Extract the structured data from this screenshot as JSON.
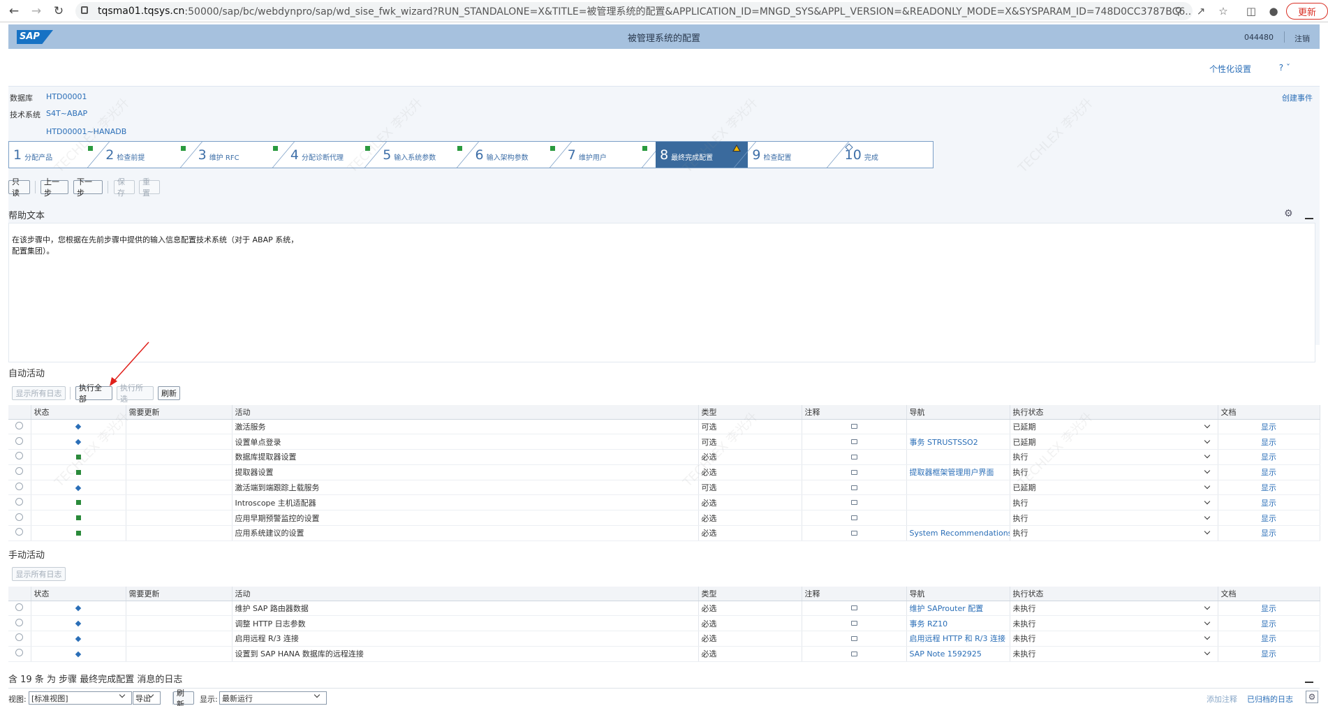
{
  "browser": {
    "url_host": "tqsma01.tqsys.cn",
    "url_rest": ":50000/sap/bc/webdynpro/sap/wd_sise_fwk_wizard?RUN_STANDALONE=X&TITLE=被管理系统的配置&APPLICATION_ID=MNGD_SYS&APPL_VERSION=&READONLY_MODE=X&SYSPARAM_ID=748D0CC3787BC6...",
    "update_label": "更新"
  },
  "header": {
    "logo": "SAP",
    "title": "被管理系统的配置",
    "user": "044480",
    "logout": "注销"
  },
  "toolbar": {
    "personalize": "个性化设置",
    "help": "?",
    "create_event": "创建事件"
  },
  "info": {
    "db_label": "数据库",
    "db_value": "HTD00001",
    "tech_label": "技术系统",
    "tech_value": "S4T~ABAP",
    "tech_value2": "HTD00001~HANADB"
  },
  "steps": [
    {
      "num": "1",
      "label": "分配产品",
      "status": "done"
    },
    {
      "num": "2",
      "label": "检查前提",
      "status": "done"
    },
    {
      "num": "3",
      "label": "维护 RFC",
      "status": "done"
    },
    {
      "num": "4",
      "label": "分配诊断代理",
      "status": "done"
    },
    {
      "num": "5",
      "label": "输入系统参数",
      "status": "done"
    },
    {
      "num": "6",
      "label": "输入架构参数",
      "status": "done"
    },
    {
      "num": "7",
      "label": "维护用户",
      "status": "done"
    },
    {
      "num": "8",
      "label": "最终完成配置",
      "status": "warning"
    },
    {
      "num": "9",
      "label": "检查配置",
      "status": "none"
    },
    {
      "num": "10",
      "label": "完成",
      "status": "pending"
    }
  ],
  "nav_buttons": {
    "readonly": "只读",
    "prev": "上一步",
    "next": "下一步",
    "save": "保存",
    "reset": "重置"
  },
  "help_section": {
    "title": "帮助文本",
    "text": "在该步骤中，您根据在先前步骤中提供的输入信息配置技术系统（对于 ABAP 系统，配置集团）。"
  },
  "auto": {
    "title": "自动活动",
    "buttons": {
      "show_all_logs": "显示所有日志",
      "execute_all": "执行全部",
      "execute_selected": "执行所选",
      "refresh": "刷新"
    },
    "columns": [
      "状态",
      "需要更新",
      "活动",
      "类型",
      "注释",
      "导航",
      "执行状态",
      "文档"
    ],
    "rows": [
      {
        "status": "diamond",
        "activity": "激活服务",
        "type": "可选",
        "nav": "",
        "exec": "已延期",
        "doc": "显示"
      },
      {
        "status": "diamond",
        "activity": "设置单点登录",
        "type": "可选",
        "nav": "事务 STRUSTSSO2",
        "exec": "已延期",
        "doc": "显示"
      },
      {
        "status": "square",
        "activity": "数据库提取器设置",
        "type": "必选",
        "nav": "",
        "exec": "执行",
        "doc": "显示"
      },
      {
        "status": "square",
        "activity": "提取器设置",
        "type": "必选",
        "nav": "提取器框架管理用户界面",
        "exec": "执行",
        "doc": "显示"
      },
      {
        "status": "diamond",
        "activity": "激活端到端跟踪上载服务",
        "type": "可选",
        "nav": "",
        "exec": "已延期",
        "doc": "显示"
      },
      {
        "status": "square",
        "activity": "Introscope 主机适配器",
        "type": "必选",
        "nav": "",
        "exec": "执行",
        "doc": "显示"
      },
      {
        "status": "square",
        "activity": "应用早期预警监控的设置",
        "type": "必选",
        "nav": "",
        "exec": "执行",
        "doc": "显示"
      },
      {
        "status": "square",
        "activity": "应用系统建议的设置",
        "type": "必选",
        "nav": "System Recommendations",
        "exec": "执行",
        "doc": "显示"
      }
    ]
  },
  "manual": {
    "title": "手动活动",
    "buttons": {
      "show_all_logs": "显示所有日志"
    },
    "columns": [
      "状态",
      "需要更新",
      "活动",
      "类型",
      "注释",
      "导航",
      "执行状态",
      "文档"
    ],
    "rows": [
      {
        "status": "diamond",
        "activity": "维护 SAP 路由器数据",
        "type": "必选",
        "nav": "维护 SAProuter 配置",
        "exec": "未执行",
        "doc": "显示"
      },
      {
        "status": "diamond",
        "activity": "调整 HTTP 日志参数",
        "type": "必选",
        "nav": "事务 RZ10",
        "exec": "未执行",
        "doc": "显示"
      },
      {
        "status": "diamond",
        "activity": "启用远程 R/3 连接",
        "type": "必选",
        "nav": "启用远程 HTTP 和 R/3 连接",
        "exec": "未执行",
        "doc": "显示"
      },
      {
        "status": "diamond",
        "activity": "设置到 SAP HANA 数据库的远程连接",
        "type": "必选",
        "nav": "SAP Note 1592925",
        "exec": "未执行",
        "doc": "显示"
      }
    ]
  },
  "log_section": {
    "title": "含 19 条 为 步骤 最终完成配置 消息的日志"
  },
  "bottom": {
    "view_label": "视图:",
    "view_value": "[标准视图]",
    "export": "导出",
    "refresh": "刷新",
    "display_label": "显示:",
    "display_value": "最新运行",
    "add_note": "添加注释",
    "archived_log": "已归档的日志"
  }
}
